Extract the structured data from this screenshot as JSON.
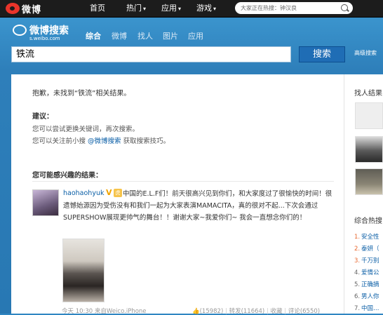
{
  "topbar": {
    "logo_text": "微博",
    "nav": [
      {
        "label": "首页",
        "caret": ""
      },
      {
        "label": "热门",
        "caret": "▾"
      },
      {
        "label": "应用",
        "caret": "▾"
      },
      {
        "label": "游戏",
        "caret": "▾"
      }
    ],
    "search_placeholder": "大家正在热搜：钟汉良",
    "icons": {
      "search": "search-icon"
    }
  },
  "search_header": {
    "brand": "微博搜索",
    "brand_sub": "s.weibo.com",
    "tabs": [
      "综合",
      "微博",
      "找人",
      "图片",
      "应用"
    ],
    "active_tab": "综合",
    "query": "铁流",
    "search_button": "搜索",
    "advanced_link": "高级搜索"
  },
  "results": {
    "not_found_msg": "抱歉，未找到“铁流”相关结果。",
    "suggestion_title": "建议：",
    "suggestion_1": "您可以尝试更换关键词，再次搜索。",
    "suggestion_2_before": "您可以关注前小搜",
    "suggestion_2_link": "@微博搜索",
    "suggestion_2_after": "获取搜索技巧。",
    "interest_title": "您可能感兴趣的结果："
  },
  "post": {
    "username": "haohaohyuk",
    "verified_badge": "V",
    "tag": "虎",
    "text": "中国的E.L.F们！前天很高兴见到你们，和大家度过了很愉快的时间！很遗憾始源因为受伤没有和我们一起为大家表演MAMACITA，真的很对不起...下次会通过SUPERSHOW展现更帅气的舞台！！谢谢大家~我爱你们~ 我会一直想念你们的！",
    "time": "今天 10:30",
    "source": "来自Weico.iPhone",
    "likes": "(15982)",
    "reposts": "转发(11664)",
    "favorite": "收藏",
    "comments": "评论(6550)"
  },
  "sidebar": {
    "people_title": "找人结果",
    "hot_title": "综合热搜",
    "hot_items": [
      {
        "num": "1.",
        "text": "安全性",
        "color": "#e8682f"
      },
      {
        "num": "2.",
        "text": "泰妍（",
        "color": "#e8682f"
      },
      {
        "num": "3.",
        "text": "千万别",
        "color": "#e8682f"
      },
      {
        "num": "4.",
        "text": "爱情公",
        "color": "#666666"
      },
      {
        "num": "5.",
        "text": "正确摘",
        "color": "#666666"
      },
      {
        "num": "6.",
        "text": "男人你",
        "color": "#666666"
      },
      {
        "num": "7.",
        "text": "中国…",
        "color": "#666666"
      }
    ]
  }
}
